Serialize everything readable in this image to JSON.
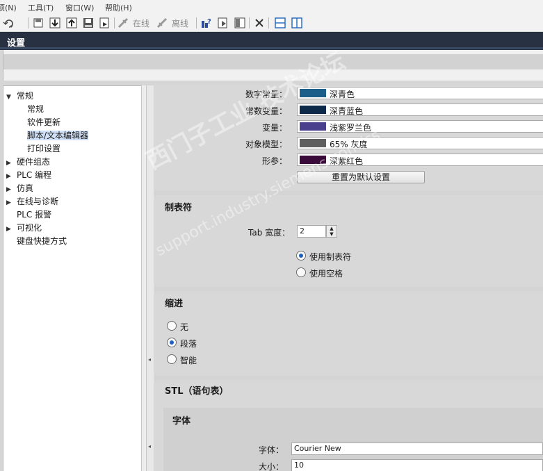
{
  "menu": [
    "项(N)",
    "工具(T)",
    "窗口(W)",
    "帮助(H)"
  ],
  "toolbar": {
    "online_label": "在线",
    "offline_label": "离线",
    "icons": [
      "undo-icon",
      "save-project-icon",
      "download-icon",
      "upload-icon",
      "save-icon",
      "compile-icon",
      "go-online-icon",
      "go-offline-icon",
      "help-icon",
      "monitor-icon",
      "split-icon",
      "close-icon",
      "split-horizontal-icon",
      "split-vertical-icon"
    ]
  },
  "window": {
    "title": "设置"
  },
  "tree": {
    "items": [
      {
        "label": "常规",
        "expanded": true,
        "level": 0
      },
      {
        "label": "常规",
        "level": 1
      },
      {
        "label": "软件更新",
        "level": 1
      },
      {
        "label": "脚本/文本编辑器",
        "level": 1,
        "selected": true
      },
      {
        "label": "打印设置",
        "level": 1
      },
      {
        "label": "硬件组态",
        "expandable": true,
        "level": 0
      },
      {
        "label": "PLC 编程",
        "expandable": true,
        "level": 0
      },
      {
        "label": "仿真",
        "expandable": true,
        "level": 0
      },
      {
        "label": "在线与诊断",
        "expandable": true,
        "level": 0
      },
      {
        "label": "PLC 报警",
        "level": 0
      },
      {
        "label": "可视化",
        "expandable": true,
        "level": 0
      },
      {
        "label": "键盘快捷方式",
        "level": 0
      }
    ]
  },
  "colors": {
    "rows": [
      {
        "label": "数字常量：",
        "value": "深青色",
        "swatch": "#1b5e8a"
      },
      {
        "label": "常数变量：",
        "value": "深青蓝色",
        "swatch": "#0d2a4a"
      },
      {
        "label": "变量：",
        "value": "浅紫罗兰色",
        "swatch": "#4a3f8c"
      },
      {
        "label": "对象模型：",
        "value": "65% 灰度",
        "swatch": "#5f5f5f"
      },
      {
        "label": "形参：",
        "value": "深紫红色",
        "swatch": "#3a0a3a"
      }
    ],
    "reset_button": "重置为默认设置"
  },
  "tabs_section": {
    "title": "制表符",
    "tab_width_label": "Tab 宽度：",
    "tab_width_value": "2",
    "options": [
      {
        "label": "使用制表符",
        "selected": true
      },
      {
        "label": "使用空格",
        "selected": false
      }
    ]
  },
  "indent_section": {
    "title": "缩进",
    "options": [
      {
        "label": "无",
        "selected": false
      },
      {
        "label": "段落",
        "selected": true
      },
      {
        "label": "智能",
        "selected": false
      }
    ]
  },
  "stl_section": {
    "title": "STL（语句表）",
    "font_group_title": "字体",
    "font_label": "字体：",
    "font_value": "Courier New",
    "size_label": "大小：",
    "size_value": "10"
  },
  "watermark": {
    "line1": "西门子工业 技术论坛",
    "line2": "support.industry.siemens.com/cs"
  }
}
